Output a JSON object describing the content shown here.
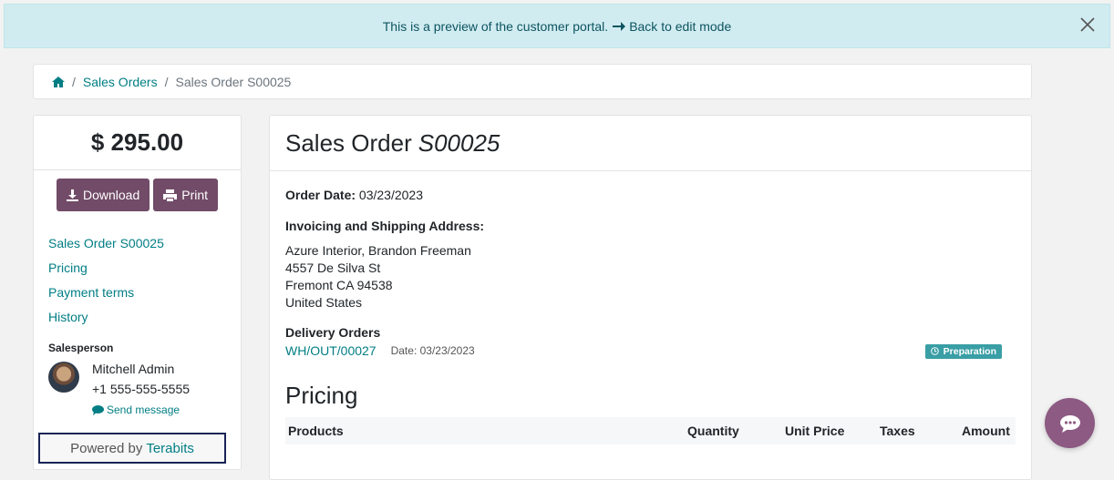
{
  "banner": {
    "text": "This is a preview of the customer portal.",
    "back_link": "Back to edit mode"
  },
  "breadcrumb": {
    "items": [
      "Sales Orders",
      "Sales Order S00025"
    ]
  },
  "sidebar": {
    "total": "$ 295.00",
    "download_label": "Download",
    "print_label": "Print",
    "nav": [
      "Sales Order S00025",
      "Pricing",
      "Payment terms",
      "History"
    ],
    "salesperson_title": "Salesperson",
    "salesperson_name": "Mitchell Admin",
    "salesperson_phone": "+1 555-555-5555",
    "send_message": "Send message",
    "powered_by": "Powered by",
    "powered_brand": "Terabits"
  },
  "main": {
    "title_prefix": "Sales Order",
    "title_ref": "S00025",
    "order_date_label": "Order Date:",
    "order_date": "03/23/2023",
    "address_label": "Invoicing and Shipping Address:",
    "address": [
      "Azure Interior, Brandon Freeman",
      "4557 De Silva St",
      "Fremont CA 94538",
      "United States"
    ],
    "delivery_label": "Delivery Orders",
    "delivery_ref": "WH/OUT/00027",
    "delivery_date_label": "Date:",
    "delivery_date": "03/23/2023",
    "delivery_status": "Preparation",
    "pricing_title": "Pricing",
    "columns": [
      "Products",
      "Quantity",
      "Unit Price",
      "Taxes",
      "Amount"
    ]
  },
  "colors": {
    "accent": "#017e84",
    "primary_button": "#714b67",
    "chat": "#8c5a82",
    "banner_bg": "#d1ecf1",
    "badge": "#3a9ea5"
  },
  "icons": [
    "close-icon",
    "home-icon",
    "download-icon",
    "print-icon",
    "comment-icon",
    "clock-icon",
    "chat-icon",
    "arrow-right-icon"
  ]
}
